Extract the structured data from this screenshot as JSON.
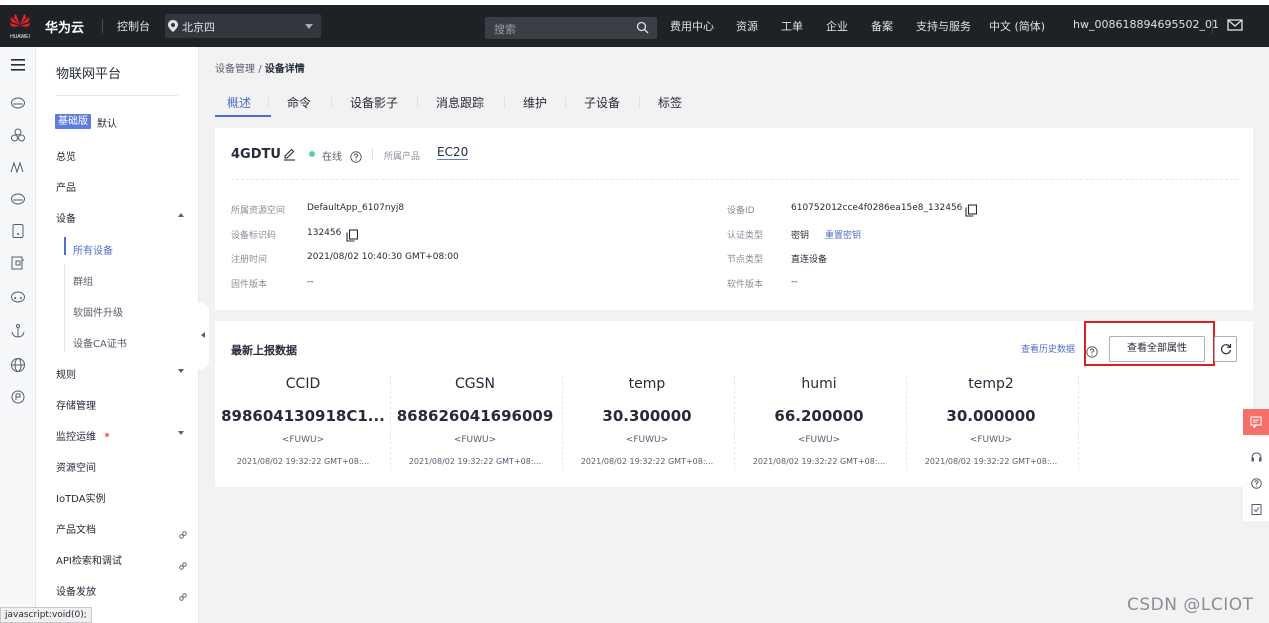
{
  "topbar": {
    "logo_text": "HUAWEI",
    "brand": "华为云",
    "console": "控制台",
    "region": "北京四",
    "search_placeholder": "搜索",
    "nav": [
      "费用中心",
      "资源",
      "工单",
      "企业",
      "备案",
      "支持与服务",
      "中文 (简体)",
      "hw_008618894695502_01"
    ]
  },
  "sidebar": {
    "title": "物联网平台",
    "edition_badge": "基础版",
    "edition_note": "默认",
    "items": {
      "overview": "总览",
      "products": "产品",
      "devices": "设备",
      "all_devices": "所有设备",
      "groups": "群组",
      "firmware": "软固件升级",
      "ca_cert": "设备CA证书",
      "rules": "规则",
      "storage": "存储管理",
      "monitor": "监控运维",
      "resource_space": "资源空间",
      "iotda_instance": "IoTDA实例",
      "product_docs": "产品文档",
      "api_explorer": "API检索和调试",
      "provisioning": "设备发放"
    }
  },
  "status_bar": "javascript:void(0);",
  "breadcrumb": {
    "parent": "设备管理",
    "sep": "/",
    "current": "设备详情"
  },
  "tabs": [
    "概述",
    "命令",
    "设备影子",
    "消息跟踪",
    "维护",
    "子设备",
    "标签"
  ],
  "device": {
    "name": "4GDTU",
    "status": "在线",
    "product_label": "所属产品",
    "product": "EC20",
    "left_fields": [
      {
        "label": "所属资源空间",
        "value": "DefaultApp_6107nyj8"
      },
      {
        "label": "设备标识码",
        "value": "132456"
      },
      {
        "label": "注册时间",
        "value": "2021/08/02 10:40:30 GMT+08:00"
      },
      {
        "label": "固件版本",
        "value": "--"
      }
    ],
    "right_fields": [
      {
        "label": "设备ID",
        "value": "610752012cce4f0286ea15e8_132456"
      },
      {
        "label": "认证类型",
        "value": "密钥",
        "link": "重置密钥"
      },
      {
        "label": "节点类型",
        "value": "直连设备"
      },
      {
        "label": "软件版本",
        "value": "--"
      }
    ]
  },
  "latest": {
    "title": "最新上报数据",
    "history_link": "查看历史数据",
    "view_all_button": "查看全部属性",
    "properties": [
      {
        "name": "CCID",
        "value": "898604130918C1...",
        "service": "<FUWU>",
        "time": "2021/08/02 19:32:22 GMT+08:..."
      },
      {
        "name": "CGSN",
        "value": "868626041696009",
        "service": "<FUWU>",
        "time": "2021/08/02 19:32:22 GMT+08:..."
      },
      {
        "name": "temp",
        "value": "30.300000",
        "service": "<FUWU>",
        "time": "2021/08/02 19:32:22 GMT+08:..."
      },
      {
        "name": "humi",
        "value": "66.200000",
        "service": "<FUWU>",
        "time": "2021/08/02 19:32:22 GMT+08:..."
      },
      {
        "name": "temp2",
        "value": "30.000000",
        "service": "<FUWU>",
        "time": "2021/08/02 19:32:22 GMT+08:..."
      }
    ]
  },
  "watermark": "CSDN @LCIOT",
  "colors": {
    "accent": "#526ecc",
    "online": "#50d4ab",
    "highlight_box": "#e02020",
    "topbar": "#1e2126"
  }
}
